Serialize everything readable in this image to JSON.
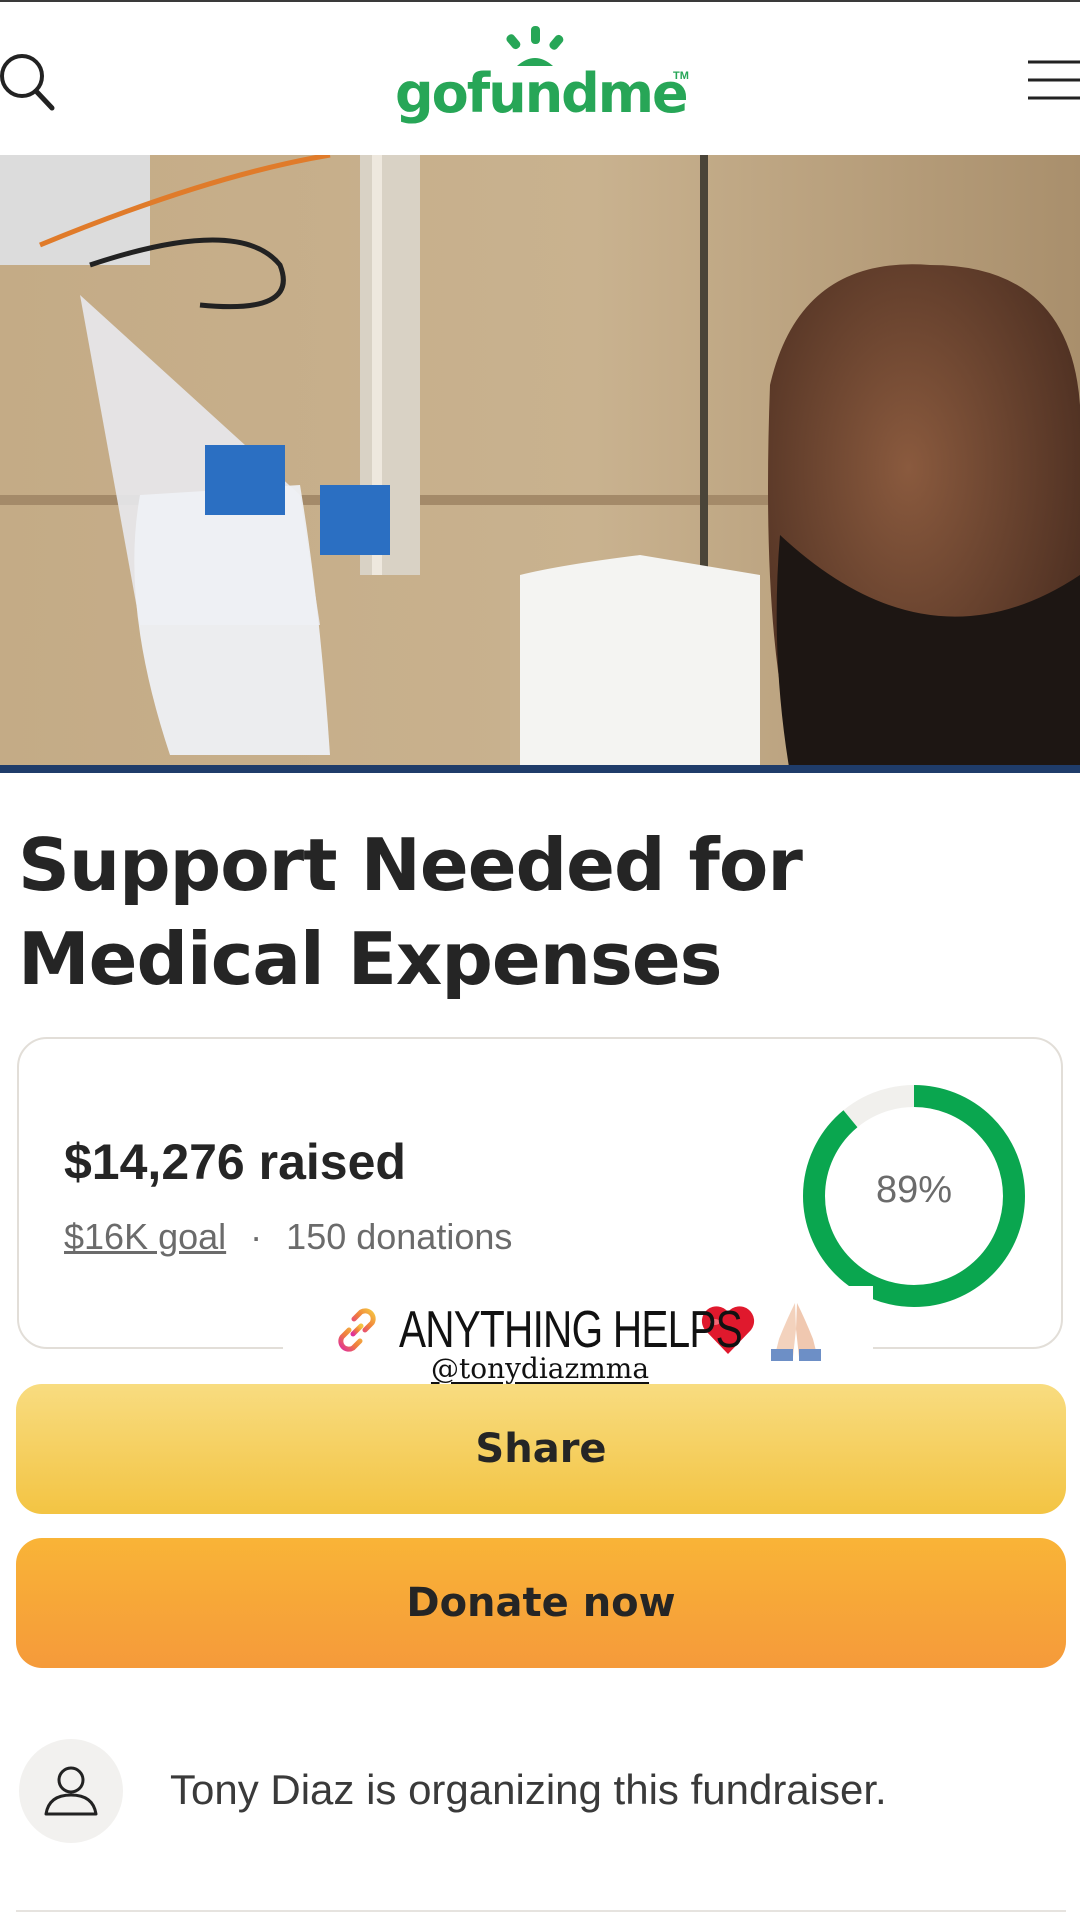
{
  "header": {
    "logo_text": "gofundme",
    "logo_tm": "TM",
    "brand_color": "#27a657"
  },
  "campaign": {
    "title": "Support Needed for Medical Expenses",
    "raised_text": "$14,276 raised",
    "goal_text": "$16K goal",
    "separator": "·",
    "donations_text": "150 donations",
    "progress_percent": 89,
    "progress_label": "89%",
    "progress_color": "#0aa64f",
    "track_color": "#f1f0ed"
  },
  "overlay": {
    "sticker_text": "ANYTHING HELPS",
    "handle": "@tonydiazmma"
  },
  "buttons": {
    "share_label": "Share",
    "donate_label": "Donate now"
  },
  "organizer": {
    "text": "Tony Diaz is organizing this fundraiser."
  }
}
